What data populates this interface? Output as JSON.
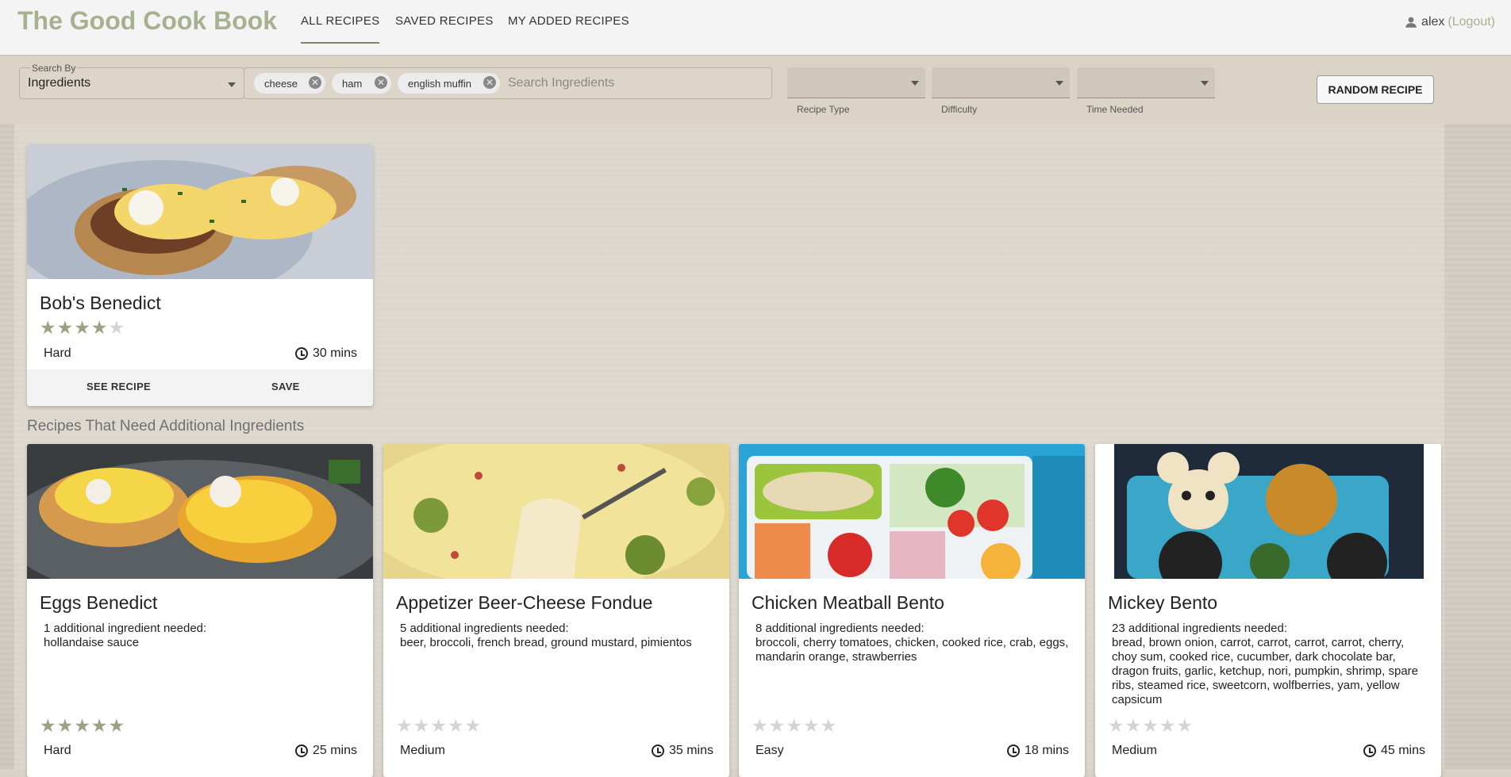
{
  "header": {
    "brand": "The Good Cook Book",
    "tabs": [
      "ALL RECIPES",
      "SAVED RECIPES",
      "MY ADDED RECIPES"
    ],
    "active_tab": "ALL RECIPES",
    "user": {
      "name": "alex",
      "logout": "(Logout)"
    }
  },
  "filters": {
    "search_by_label": "Search By",
    "search_by_value": "Ingredients",
    "chips": [
      "cheese",
      "ham",
      "english muffin"
    ],
    "search_placeholder": "Search Ingredients",
    "dropdowns": [
      "Recipe Type",
      "Difficulty",
      "Time Needed"
    ],
    "random_button": "RANDOM RECIPE"
  },
  "match_recipe": {
    "title": "Bob's Benedict",
    "rating": 4,
    "max_rating": 5,
    "difficulty": "Hard",
    "time": "30 mins",
    "see_recipe": "SEE RECIPE",
    "save": "SAVE"
  },
  "additional_section_title": "Recipes That Need Additional Ingredients",
  "additional_recipes": [
    {
      "title": "Eggs Benedict",
      "needed_header": "1 additional ingredient needed:",
      "needed": "hollandaise sauce",
      "rating": 5,
      "difficulty": "Hard",
      "time": "25 mins"
    },
    {
      "title": "Appetizer Beer-Cheese Fondue",
      "needed_header": "5 additional ingredients needed:",
      "needed": "beer, broccoli, french bread, ground mustard, pimientos",
      "rating": 0,
      "difficulty": "Medium",
      "time": "35 mins"
    },
    {
      "title": "Chicken Meatball Bento",
      "needed_header": "8 additional ingredients needed:",
      "needed": "broccoli, cherry tomatoes, chicken, cooked rice, crab, eggs, mandarin orange, strawberries",
      "rating": 0,
      "difficulty": "Easy",
      "time": "18 mins"
    },
    {
      "title": "Mickey Bento",
      "needed_header": "23 additional ingredients needed:",
      "needed": "bread, brown onion, carrot, carrot, carrot, carrot, cherry, choy sum, cooked rice, cucumber, dark chocolate bar, dragon fruits, garlic, ketchup, nori, pumpkin, shrimp, spare ribs, steamed rice, sweetcorn, wolfberries, yam, yellow capsicum",
      "rating": 0,
      "difficulty": "Medium",
      "time": "45 mins"
    }
  ]
}
